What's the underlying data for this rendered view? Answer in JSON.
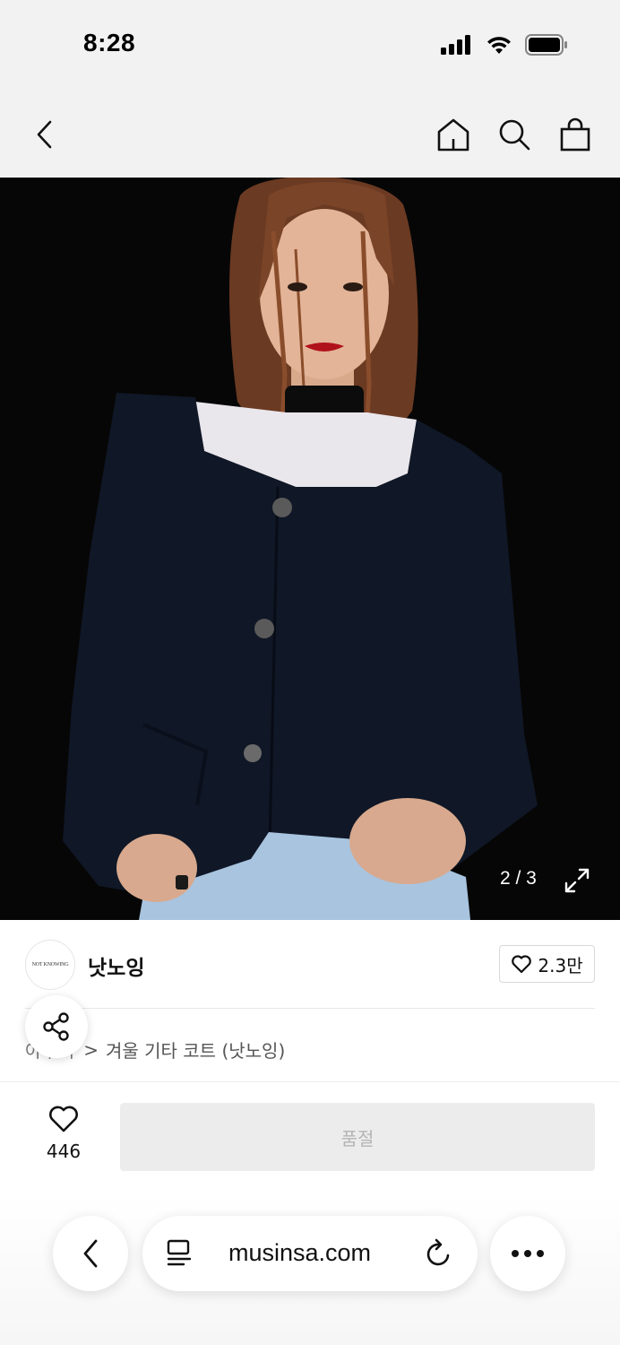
{
  "status": {
    "time": "8:28"
  },
  "hero": {
    "counter": "2 / 3"
  },
  "brand": {
    "logo_text": "NOT KNOWING",
    "name": "낫노잉",
    "like_count": "2.3만"
  },
  "breadcrumb": {
    "hidden": "아우터",
    "separator": ">",
    "path": "겨울 기타 코트 (낫노잉)"
  },
  "purchase": {
    "wish_count": "446",
    "button_label": "품절"
  },
  "browser": {
    "url": "musinsa.com"
  },
  "colors": {
    "background": "#ffffff",
    "bar_gray": "#f2f2f2",
    "soldout_bg": "#ececec",
    "soldout_text": "#b5b5b5"
  }
}
